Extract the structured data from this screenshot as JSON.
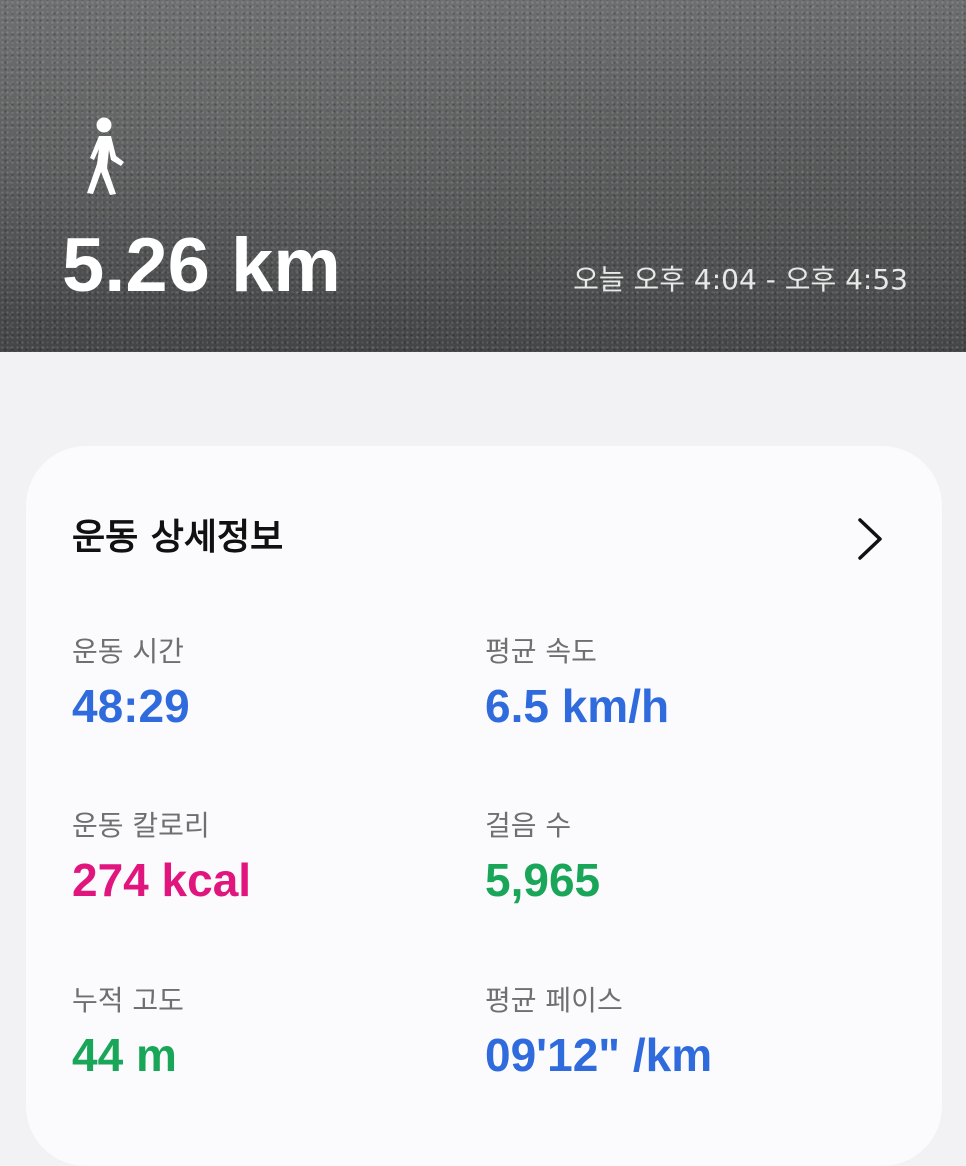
{
  "header": {
    "activity_icon": "walking-person-icon",
    "distance": "5.26 km",
    "time_range": "오늘 오후 4:04 - 오후 4:53"
  },
  "details": {
    "title": "운동 상세정보",
    "chevron_icon": "chevron-right-icon",
    "stats": [
      {
        "label": "운동 시간",
        "value": "48:29",
        "color": "#2f6bdc"
      },
      {
        "label": "평균 속도",
        "value": "6.5 km/h",
        "color": "#2f6bdc"
      },
      {
        "label": "운동 칼로리",
        "value": "274 kcal",
        "color": "#e0157e"
      },
      {
        "label": "걸음 수",
        "value": "5,965",
        "color": "#1aa659"
      },
      {
        "label": "누적 고도",
        "value": "44 m",
        "color": "#1aa659"
      },
      {
        "label": "평균 페이스",
        "value": "09'12\" /km",
        "color": "#2f6bdc"
      }
    ]
  }
}
